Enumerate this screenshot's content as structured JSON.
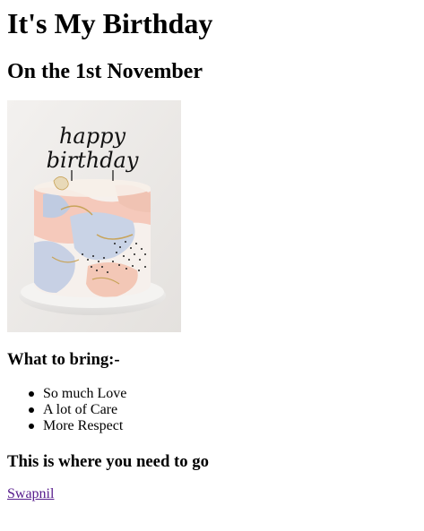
{
  "page": {
    "title": "It's My Birthday",
    "subtitle": "On the 1st November"
  },
  "image": {
    "alt": "birthday cake with happy birthday topper",
    "topper_line1": "happy",
    "topper_line2": "birthday"
  },
  "bring": {
    "heading": "What to bring:-",
    "items": [
      {
        "label": "So much Love"
      },
      {
        "label": "A lot of Care"
      },
      {
        "label": "More Respect"
      }
    ]
  },
  "location": {
    "heading": "This is where you need to go"
  },
  "link": {
    "label": "Swapnil",
    "color": "#551a8b"
  }
}
